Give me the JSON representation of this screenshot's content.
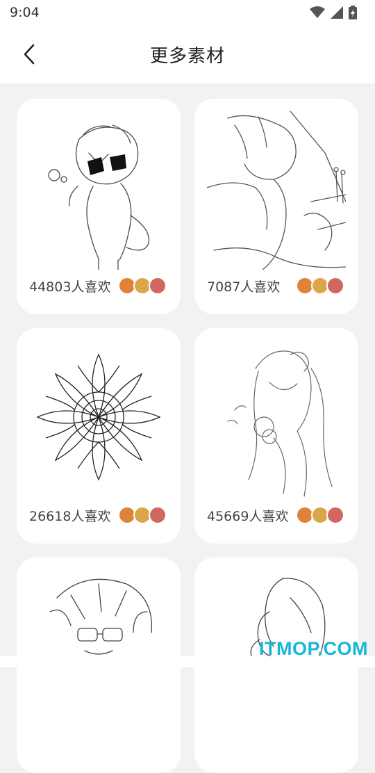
{
  "status": {
    "time": "9:04"
  },
  "header": {
    "title": "更多素材"
  },
  "cards": [
    {
      "likes": "44803人喜欢"
    },
    {
      "likes": "7087人喜欢"
    },
    {
      "likes": "26618人喜欢"
    },
    {
      "likes": "45669人喜欢"
    },
    {
      "likes": ""
    },
    {
      "likes": ""
    }
  ],
  "watermark": "ITMOP.COM",
  "colors": {
    "accent": "#18b6d6",
    "card_bg": "#ffffff",
    "page_bg": "#f2f2f2"
  }
}
